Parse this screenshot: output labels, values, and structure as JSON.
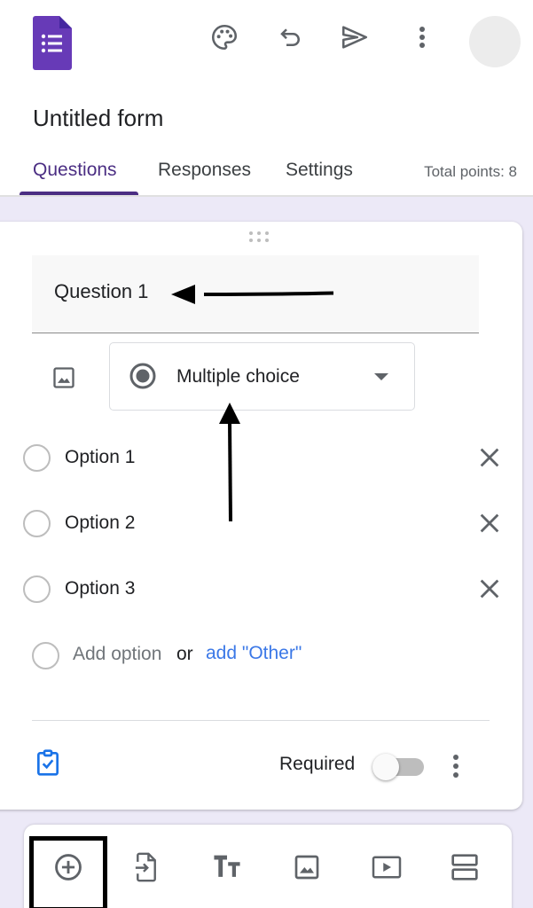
{
  "app": {
    "name": "Google Forms",
    "brand_color": "#673ab7",
    "accent_color": "#4b2e83",
    "link_color": "#3b78e7"
  },
  "topbar": {
    "icons": [
      "forms-logo-icon",
      "palette-icon",
      "undo-icon",
      "send-icon",
      "more-vert-icon",
      "avatar"
    ]
  },
  "form": {
    "title": "Untitled form"
  },
  "tabs": {
    "items": [
      {
        "label": "Questions",
        "active": true
      },
      {
        "label": "Responses",
        "active": false
      },
      {
        "label": "Settings",
        "active": false
      }
    ],
    "total_points": "Total points: 8"
  },
  "question": {
    "title": "Question 1",
    "type": "Multiple choice",
    "options": [
      {
        "label": "Option 1"
      },
      {
        "label": "Option 2"
      },
      {
        "label": "Option 3"
      }
    ],
    "add_option": "Add option",
    "or_text": "or",
    "add_other": "add \"Other\"",
    "required_label": "Required",
    "required": false
  },
  "toolbar": {
    "items": [
      {
        "name": "add-question",
        "icon": "add-circle-icon"
      },
      {
        "name": "import-questions",
        "icon": "import-icon"
      },
      {
        "name": "add-title",
        "icon": "title-text-icon"
      },
      {
        "name": "add-image",
        "icon": "image-icon"
      },
      {
        "name": "add-video",
        "icon": "video-icon"
      },
      {
        "name": "add-section",
        "icon": "section-icon"
      }
    ],
    "highlighted": "add-question"
  },
  "annotations": [
    {
      "type": "arrow",
      "points_to": "question-title"
    },
    {
      "type": "arrow",
      "points_to": "question-type-select"
    },
    {
      "type": "box",
      "surrounds": "add-question-button"
    }
  ]
}
